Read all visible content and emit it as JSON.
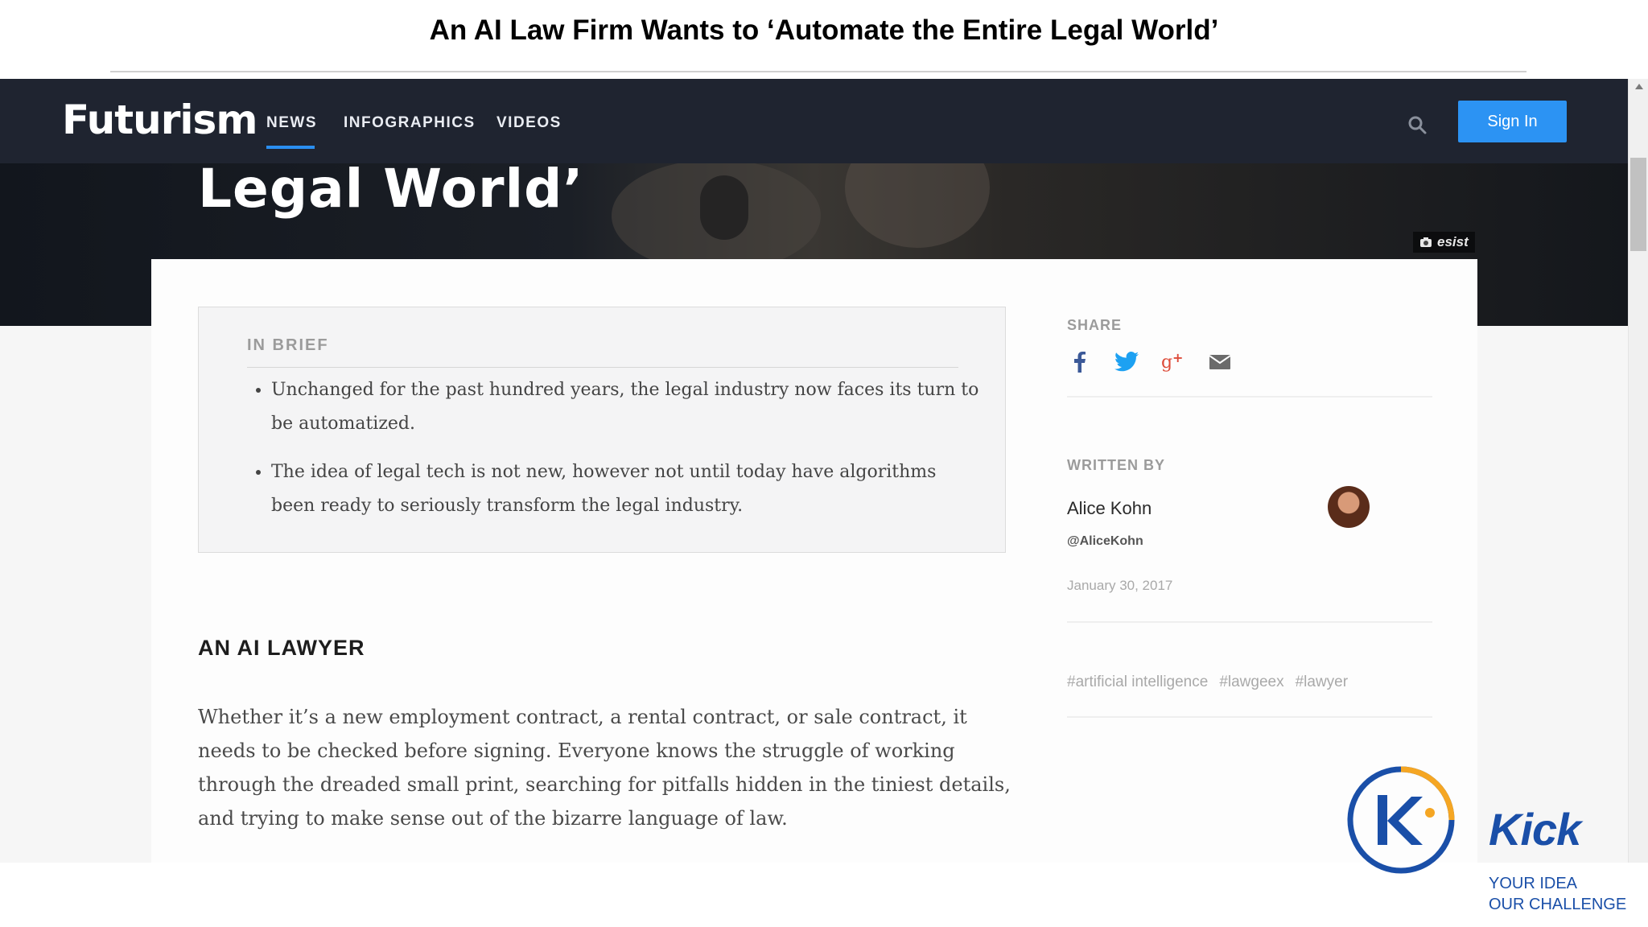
{
  "slide": {
    "title": "An AI Law Firm Wants to ‘Automate the Entire Legal World’"
  },
  "nav": {
    "logo": "Futurism",
    "items": [
      "NEWS",
      "INFOGRAPHICS",
      "VIDEOS"
    ],
    "active_item": "NEWS",
    "sign_in": "Sign In"
  },
  "hero": {
    "title_fragment": "Legal World’",
    "photo_credit": "esist"
  },
  "brief": {
    "label": "IN BRIEF",
    "bullets": [
      "Unchanged for the past hundred years, the legal industry now faces its turn to be automatized.",
      "The idea of legal tech is not new, however not until today have algorithms been ready to seriously transform the legal industry."
    ]
  },
  "article": {
    "section_title": "AN AI LAWYER",
    "paragraph": "Whether it’s a new employment contract, a rental contract, or sale contract, it needs to be checked before signing. Everyone knows the struggle of working through the dreaded small print, searching for pitfalls hidden in the tiniest details, and trying to make sense out of the bizarre language of law."
  },
  "sidebar": {
    "share_label": "SHARE",
    "share_icons": [
      "facebook-icon",
      "twitter-icon",
      "google-plus-icon",
      "email-icon"
    ],
    "written_by_label": "WRITTEN BY",
    "author_name": "Alice Kohn",
    "author_handle": "@AliceKohn",
    "date": "January 30, 2017",
    "tags": [
      "#artificial intelligence",
      "#lawgeex",
      "#lawyer"
    ]
  },
  "branding": {
    "word": "Kick",
    "tagline_line1": "YOUR IDEA",
    "tagline_line2": "OUR CHALLENGE"
  },
  "colors": {
    "nav_bg": "#1f2430",
    "accent_blue": "#2c93f3",
    "kick_blue": "#1a4fa8",
    "kick_orange": "#f5a623"
  }
}
